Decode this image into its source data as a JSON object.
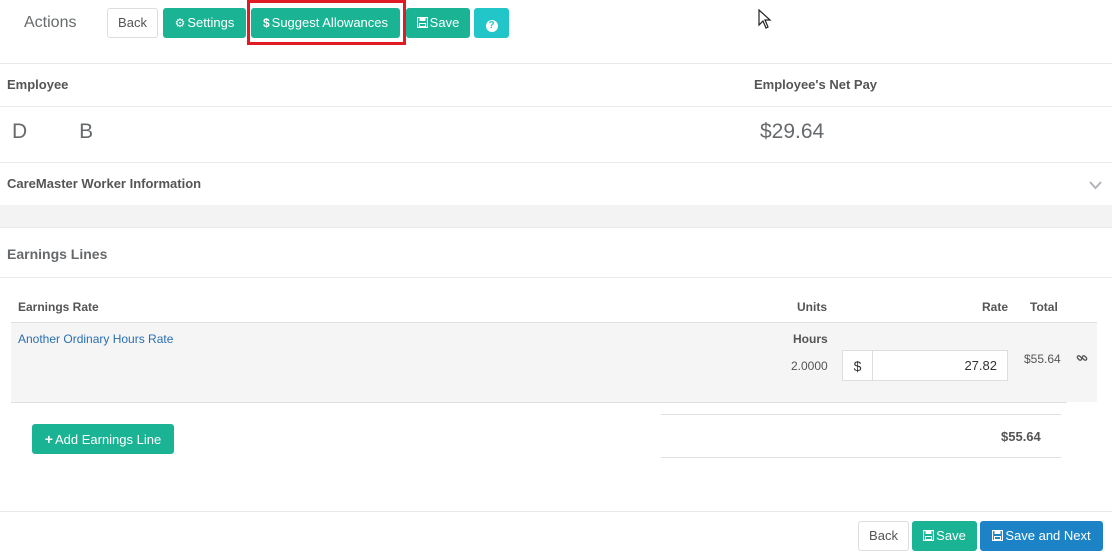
{
  "toolbar": {
    "title": "Actions",
    "back_label": "Back",
    "settings_label": "Settings",
    "suggest_label": "Suggest Allowances",
    "save_label": "Save",
    "help_icon": "question-circle-icon"
  },
  "employee_header": {
    "employee_col": "Employee",
    "net_pay_col": "Employee's Net Pay"
  },
  "employee": {
    "first_initial": "D",
    "last_initial": "B",
    "net_pay": "$29.64"
  },
  "caremaster": {
    "title": "CareMaster Worker Information"
  },
  "earnings": {
    "title": "Earnings Lines",
    "columns": {
      "rate": "Earnings Rate",
      "units": "Units",
      "rate_col": "Rate",
      "total": "Total"
    },
    "lines": [
      {
        "name": "Another Ordinary Hours Rate",
        "unit_type": "Hours",
        "units": "2.0000",
        "currency": "$",
        "rate": "27.82",
        "total": "$55.64"
      }
    ],
    "add_label": "Add Earnings Line",
    "grand_total": "$55.64"
  },
  "footer": {
    "back_label": "Back",
    "save_label": "Save",
    "save_next_label": "Save and Next"
  },
  "colors": {
    "green": "#1ab394",
    "cyan": "#23c6c8",
    "blue": "#1c84c6",
    "highlight": "#e01b24"
  }
}
